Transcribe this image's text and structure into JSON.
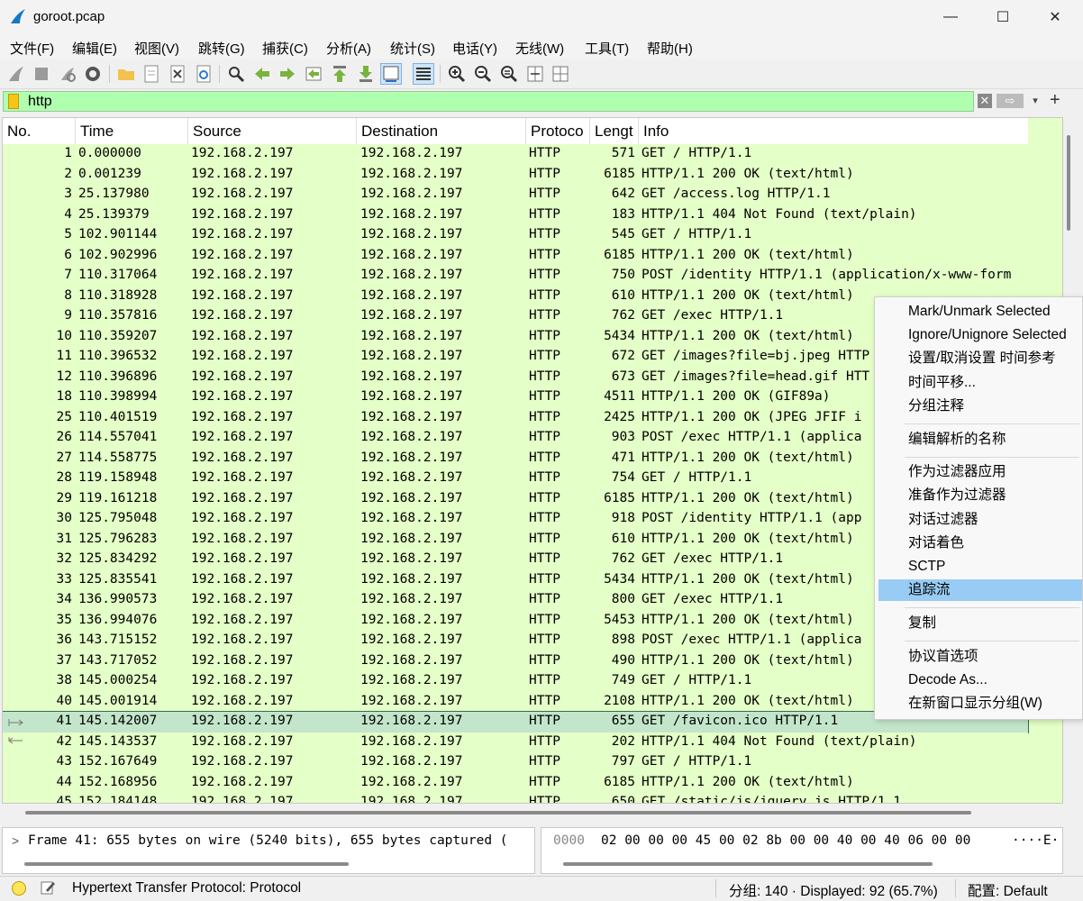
{
  "window": {
    "title": "goroot.pcap",
    "minimize": "—",
    "maximize": "☐",
    "close": "✕"
  },
  "menu": [
    "文件(F)",
    "编辑(E)",
    "视图(V)",
    "跳转(G)",
    "捕获(C)",
    "分析(A)",
    "统计(S)",
    "电话(Y)",
    "无线(W)",
    "工具(T)",
    "帮助(H)"
  ],
  "toolbar_icons": [
    "shark-fin-start-icon",
    "stop-capture-icon",
    "restart-capture-icon",
    "capture-options-icon",
    "open-file-icon",
    "save-file-icon",
    "close-file-icon",
    "reload-file-icon",
    "find-packet-icon",
    "go-back-icon",
    "go-forward-icon",
    "go-to-packet-icon",
    "go-first-icon",
    "go-last-icon",
    "autoscroll-icon",
    "colorize-icon",
    "zoom-in-icon",
    "zoom-out-icon",
    "normal-size-icon",
    "resize-columns-icon",
    "layout-icon"
  ],
  "filter": {
    "value": "http",
    "clear": "✕",
    "apply": "⇨",
    "dropdown": "▾",
    "add": "+"
  },
  "columns": [
    "No.",
    "Time",
    "Source",
    "Destination",
    "Protoco",
    "Lengt",
    "Info"
  ],
  "packets": [
    {
      "no": "1",
      "time": "0.000000",
      "src": "192.168.2.197",
      "dst": "192.168.2.197",
      "proto": "HTTP",
      "len": "571",
      "info": "GET / HTTP/1.1"
    },
    {
      "no": "2",
      "time": "0.001239",
      "src": "192.168.2.197",
      "dst": "192.168.2.197",
      "proto": "HTTP",
      "len": "6185",
      "info": "HTTP/1.1 200 OK  (text/html)"
    },
    {
      "no": "3",
      "time": "25.137980",
      "src": "192.168.2.197",
      "dst": "192.168.2.197",
      "proto": "HTTP",
      "len": "642",
      "info": "GET /access.log HTTP/1.1"
    },
    {
      "no": "4",
      "time": "25.139379",
      "src": "192.168.2.197",
      "dst": "192.168.2.197",
      "proto": "HTTP",
      "len": "183",
      "info": "HTTP/1.1 404 Not Found  (text/plain)"
    },
    {
      "no": "5",
      "time": "102.901144",
      "src": "192.168.2.197",
      "dst": "192.168.2.197",
      "proto": "HTTP",
      "len": "545",
      "info": "GET / HTTP/1.1"
    },
    {
      "no": "6",
      "time": "102.902996",
      "src": "192.168.2.197",
      "dst": "192.168.2.197",
      "proto": "HTTP",
      "len": "6185",
      "info": "HTTP/1.1 200 OK  (text/html)"
    },
    {
      "no": "7",
      "time": "110.317064",
      "src": "192.168.2.197",
      "dst": "192.168.2.197",
      "proto": "HTTP",
      "len": "750",
      "info": "POST /identity HTTP/1.1  (application/x-www-form"
    },
    {
      "no": "8",
      "time": "110.318928",
      "src": "192.168.2.197",
      "dst": "192.168.2.197",
      "proto": "HTTP",
      "len": "610",
      "info": "HTTP/1.1 200 OK  (text/html)"
    },
    {
      "no": "9",
      "time": "110.357816",
      "src": "192.168.2.197",
      "dst": "192.168.2.197",
      "proto": "HTTP",
      "len": "762",
      "info": "GET /exec HTTP/1.1"
    },
    {
      "no": "10",
      "time": "110.359207",
      "src": "192.168.2.197",
      "dst": "192.168.2.197",
      "proto": "HTTP",
      "len": "5434",
      "info": "HTTP/1.1 200 OK  (text/html)"
    },
    {
      "no": "11",
      "time": "110.396532",
      "src": "192.168.2.197",
      "dst": "192.168.2.197",
      "proto": "HTTP",
      "len": "672",
      "info": "GET /images?file=bj.jpeg HTTP"
    },
    {
      "no": "12",
      "time": "110.396896",
      "src": "192.168.2.197",
      "dst": "192.168.2.197",
      "proto": "HTTP",
      "len": "673",
      "info": "GET /images?file=head.gif HTT"
    },
    {
      "no": "18",
      "time": "110.398994",
      "src": "192.168.2.197",
      "dst": "192.168.2.197",
      "proto": "HTTP",
      "len": "4511",
      "info": "HTTP/1.1 200 OK  (GIF89a)"
    },
    {
      "no": "25",
      "time": "110.401519",
      "src": "192.168.2.197",
      "dst": "192.168.2.197",
      "proto": "HTTP",
      "len": "2425",
      "info": "HTTP/1.1 200 OK  (JPEG JFIF i"
    },
    {
      "no": "26",
      "time": "114.557041",
      "src": "192.168.2.197",
      "dst": "192.168.2.197",
      "proto": "HTTP",
      "len": "903",
      "info": "POST /exec HTTP/1.1  (applica"
    },
    {
      "no": "27",
      "time": "114.558775",
      "src": "192.168.2.197",
      "dst": "192.168.2.197",
      "proto": "HTTP",
      "len": "471",
      "info": "HTTP/1.1 200 OK  (text/html)"
    },
    {
      "no": "28",
      "time": "119.158948",
      "src": "192.168.2.197",
      "dst": "192.168.2.197",
      "proto": "HTTP",
      "len": "754",
      "info": "GET / HTTP/1.1"
    },
    {
      "no": "29",
      "time": "119.161218",
      "src": "192.168.2.197",
      "dst": "192.168.2.197",
      "proto": "HTTP",
      "len": "6185",
      "info": "HTTP/1.1 200 OK  (text/html)"
    },
    {
      "no": "30",
      "time": "125.795048",
      "src": "192.168.2.197",
      "dst": "192.168.2.197",
      "proto": "HTTP",
      "len": "918",
      "info": "POST /identity HTTP/1.1  (app"
    },
    {
      "no": "31",
      "time": "125.796283",
      "src": "192.168.2.197",
      "dst": "192.168.2.197",
      "proto": "HTTP",
      "len": "610",
      "info": "HTTP/1.1 200 OK  (text/html)"
    },
    {
      "no": "32",
      "time": "125.834292",
      "src": "192.168.2.197",
      "dst": "192.168.2.197",
      "proto": "HTTP",
      "len": "762",
      "info": "GET /exec HTTP/1.1"
    },
    {
      "no": "33",
      "time": "125.835541",
      "src": "192.168.2.197",
      "dst": "192.168.2.197",
      "proto": "HTTP",
      "len": "5434",
      "info": "HTTP/1.1 200 OK  (text/html)"
    },
    {
      "no": "34",
      "time": "136.990573",
      "src": "192.168.2.197",
      "dst": "192.168.2.197",
      "proto": "HTTP",
      "len": "800",
      "info": "GET /exec HTTP/1.1"
    },
    {
      "no": "35",
      "time": "136.994076",
      "src": "192.168.2.197",
      "dst": "192.168.2.197",
      "proto": "HTTP",
      "len": "5453",
      "info": "HTTP/1.1 200 OK  (text/html)"
    },
    {
      "no": "36",
      "time": "143.715152",
      "src": "192.168.2.197",
      "dst": "192.168.2.197",
      "proto": "HTTP",
      "len": "898",
      "info": "POST /exec HTTP/1.1  (applica"
    },
    {
      "no": "37",
      "time": "143.717052",
      "src": "192.168.2.197",
      "dst": "192.168.2.197",
      "proto": "HTTP",
      "len": "490",
      "info": "HTTP/1.1 200 OK  (text/html)"
    },
    {
      "no": "38",
      "time": "145.000254",
      "src": "192.168.2.197",
      "dst": "192.168.2.197",
      "proto": "HTTP",
      "len": "749",
      "info": "GET / HTTP/1.1"
    },
    {
      "no": "40",
      "time": "145.001914",
      "src": "192.168.2.197",
      "dst": "192.168.2.197",
      "proto": "HTTP",
      "len": "2108",
      "info": "HTTP/1.1 200 OK  (text/html)"
    },
    {
      "no": "41",
      "time": "145.142007",
      "src": "192.168.2.197",
      "dst": "192.168.2.197",
      "proto": "HTTP",
      "len": "655",
      "info": "GET /favicon.ico HTTP/1.1",
      "selected": true
    },
    {
      "no": "42",
      "time": "145.143537",
      "src": "192.168.2.197",
      "dst": "192.168.2.197",
      "proto": "HTTP",
      "len": "202",
      "info": "HTTP/1.1 404 Not Found  (text/plain)"
    },
    {
      "no": "43",
      "time": "152.167649",
      "src": "192.168.2.197",
      "dst": "192.168.2.197",
      "proto": "HTTP",
      "len": "797",
      "info": "GET / HTTP/1.1"
    },
    {
      "no": "44",
      "time": "152.168956",
      "src": "192.168.2.197",
      "dst": "192.168.2.197",
      "proto": "HTTP",
      "len": "6185",
      "info": "HTTP/1.1 200 OK  (text/html)"
    },
    {
      "no": "45",
      "time": "152.184148",
      "src": "192.168.2.197",
      "dst": "192.168.2.197",
      "proto": "HTTP",
      "len": "650",
      "info": "GET /static/js/jquery.js HTTP/1.1"
    }
  ],
  "detail": {
    "text": "Frame 41: 655 bytes on wire (5240 bits), 655 bytes captured ("
  },
  "bytes": {
    "offset": "0000",
    "hex": "02 00 00 00 45 00 02 8b  00 00 40 00 40 06 00 00",
    "ascii": "····E·"
  },
  "status": {
    "protocol": "Hypertext Transfer Protocol: Protocol",
    "counts": "分组: 140 · Displayed: 92 (65.7%)",
    "profile": "配置:  Default"
  },
  "context_menu": {
    "items": [
      {
        "label": "Mark/Unmark Selected"
      },
      {
        "label": "Ignore/Unignore Selected"
      },
      {
        "label": "设置/取消设置 时间参考"
      },
      {
        "label": "时间平移..."
      },
      {
        "label": "分组注释"
      },
      {
        "label": "编辑解析的名称",
        "sep_before": true
      },
      {
        "label": "作为过滤器应用",
        "sep_before": true
      },
      {
        "label": "准备作为过滤器"
      },
      {
        "label": "对话过滤器"
      },
      {
        "label": "对话着色"
      },
      {
        "label": "SCTP"
      },
      {
        "label": "追踪流",
        "highlight": true
      },
      {
        "label": "复制",
        "sep_before": true
      },
      {
        "label": "协议首选项",
        "sep_before": true
      },
      {
        "label": "Decode As..."
      },
      {
        "label": "在新窗口显示分组(W)"
      }
    ]
  },
  "colors": {
    "row_bg": "#e4ffc7",
    "filter_bg": "#afffaf",
    "selected_row": "#c3e6cb",
    "menu_highlight": "#99ccf4"
  }
}
